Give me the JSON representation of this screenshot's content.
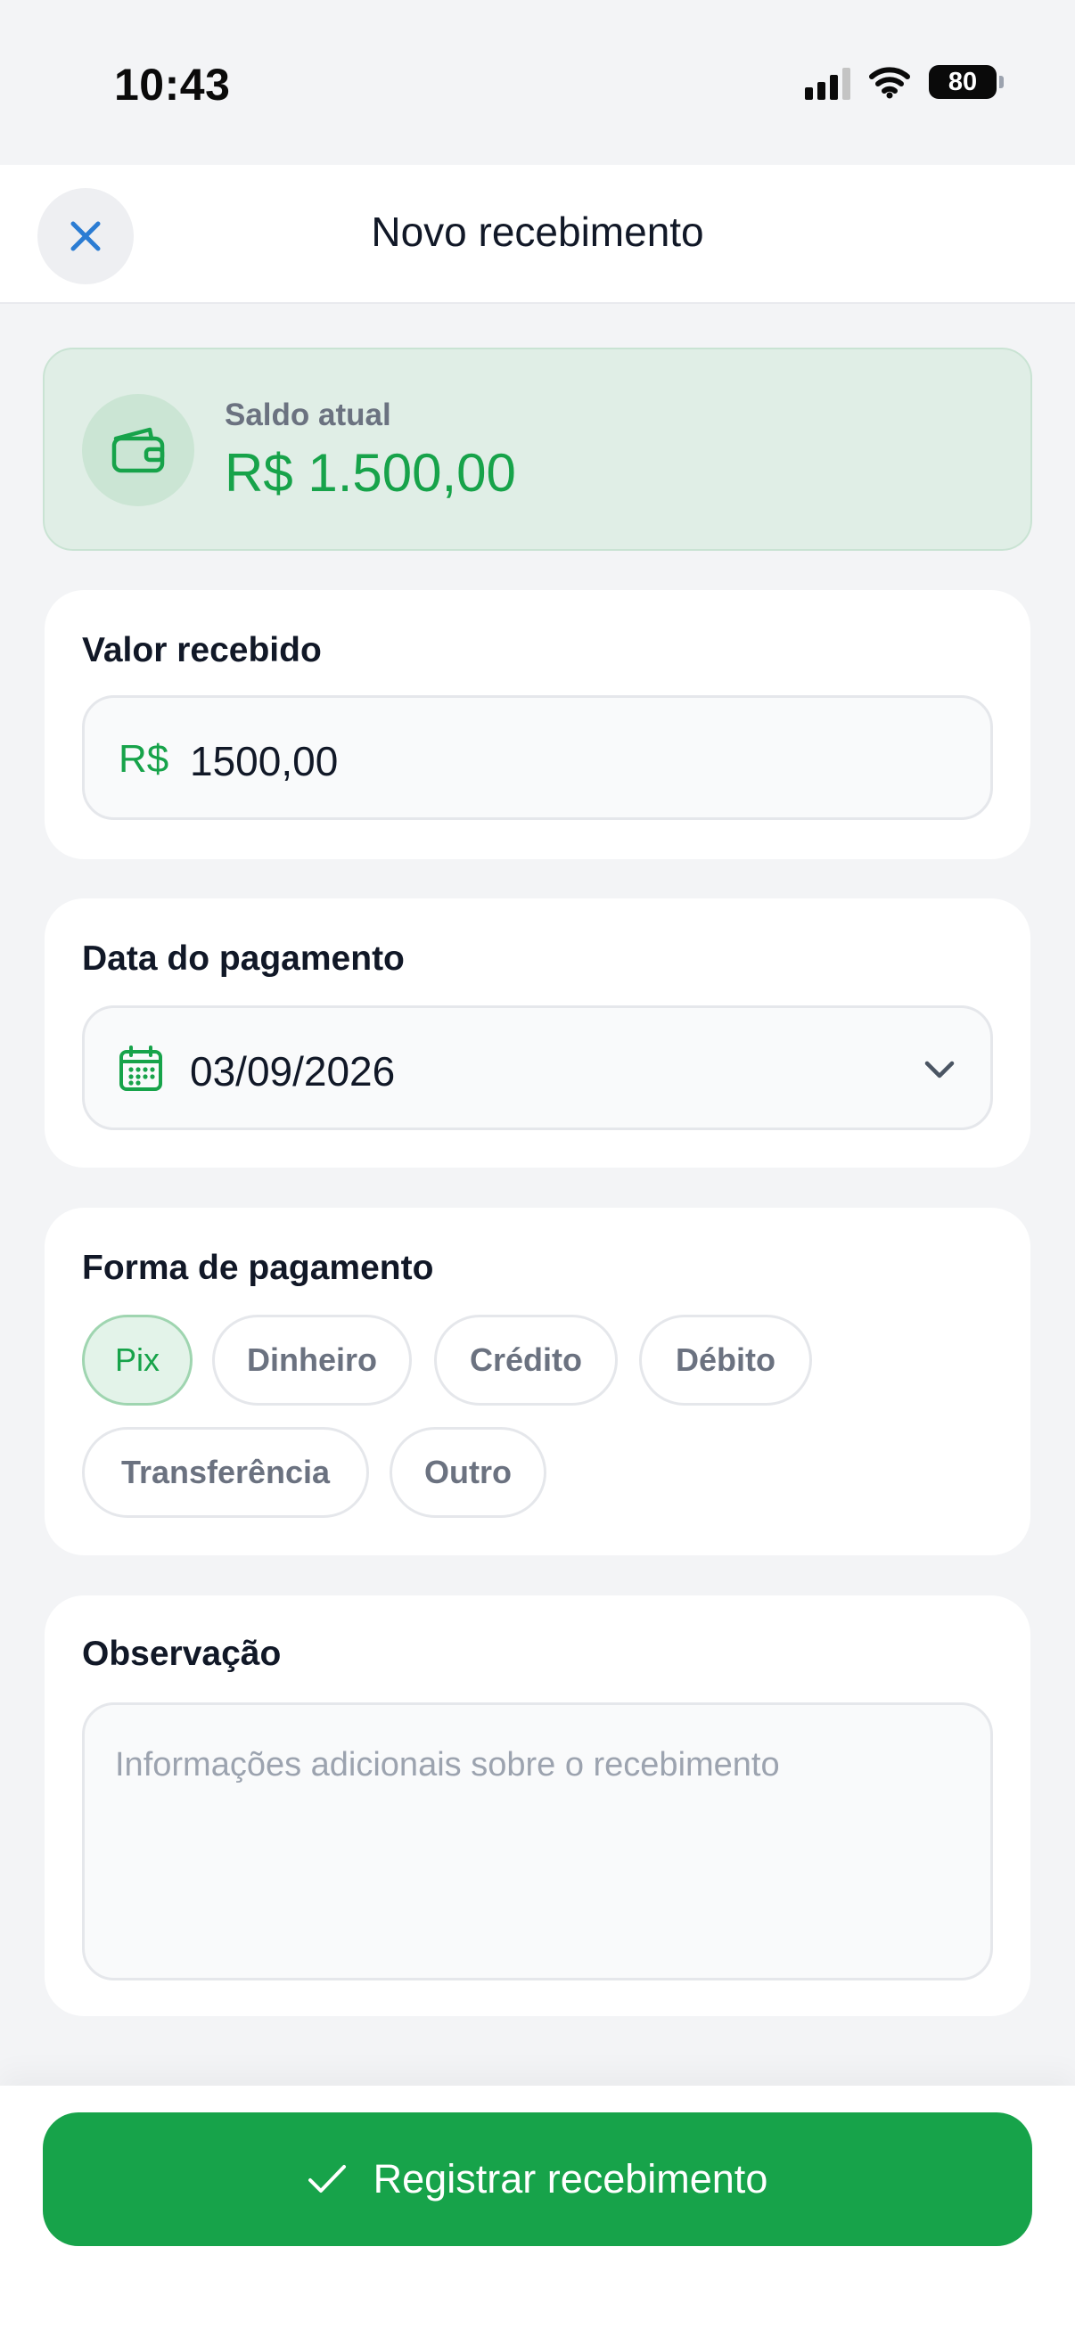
{
  "status_bar": {
    "time": "10:43",
    "battery": "80",
    "icons": [
      "signal-icon",
      "wifi-icon",
      "battery-icon"
    ]
  },
  "header": {
    "title": "Novo recebimento",
    "close_icon": "close-icon"
  },
  "balance": {
    "label": "Saldo atual",
    "value": "R$ 1.500,00",
    "icon": "wallet-icon"
  },
  "amount": {
    "label": "Valor recebido",
    "currency": "R$",
    "value": "1500,00"
  },
  "payment_date": {
    "label": "Data do pagamento",
    "value": "03/09/2026",
    "icon": "calendar-icon"
  },
  "payment_method": {
    "label": "Forma de pagamento",
    "selected": "Pix",
    "options": [
      "Pix",
      "Dinheiro",
      "Crédito",
      "Débito",
      "Transferência",
      "Outro"
    ]
  },
  "note": {
    "label": "Observação",
    "placeholder": "Informações adicionais sobre o recebimento"
  },
  "submit": {
    "label": "Registrar recebimento",
    "icon": "check-icon"
  },
  "colors": {
    "accent": "#17a34a",
    "accent_light": "#e0eee6",
    "close_icon": "#2b7cd3",
    "background": "#f3f4f6"
  }
}
